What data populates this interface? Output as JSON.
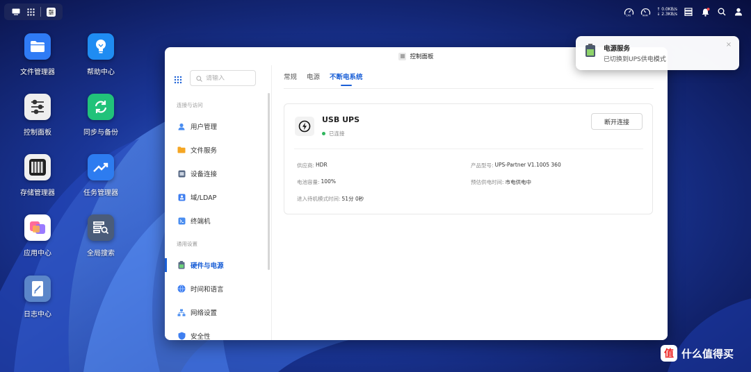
{
  "topbar": {
    "net_up": "0.0KB/s",
    "net_down": "2.3KB/s"
  },
  "desktop": {
    "icons": [
      {
        "label": "文件管理器",
        "icon": "folder-icon",
        "color": "#2f7bf5"
      },
      {
        "label": "帮助中心",
        "icon": "lightbulb-icon",
        "color": "#1f8cf2"
      },
      {
        "label": "控制面板",
        "icon": "sliders-icon",
        "color": "#eeeeee"
      },
      {
        "label": "同步与备份",
        "icon": "sync-icon",
        "color": "#21c27a"
      },
      {
        "label": "存储管理器",
        "icon": "storage-icon",
        "color": "#f0f0f0"
      },
      {
        "label": "任务管理器",
        "icon": "chart-trend-icon",
        "color": "#2d7cf0"
      },
      {
        "label": "应用中心",
        "icon": "apps-icon",
        "color": "#ffffff"
      },
      {
        "label": "全局搜索",
        "icon": "search-panel-icon",
        "color": "#4a5c7a"
      },
      {
        "label": "日志中心",
        "icon": "log-icon",
        "color": "#5b86c9"
      }
    ]
  },
  "window": {
    "title": "控制面板",
    "search_placeholder": "请输入",
    "sections": [
      {
        "heading": "连接与访问"
      },
      {
        "heading": "通用设置"
      }
    ],
    "nav": [
      {
        "label": "用户管理",
        "icon": "user-icon"
      },
      {
        "label": "文件服务",
        "icon": "folder-icon"
      },
      {
        "label": "设备连接",
        "icon": "device-icon"
      },
      {
        "label": "域/LDAP",
        "icon": "domain-icon"
      },
      {
        "label": "终端机",
        "icon": "terminal-icon"
      },
      {
        "label": "硬件与电源",
        "icon": "battery-icon",
        "active": true
      },
      {
        "label": "时间和语言",
        "icon": "globe-icon"
      },
      {
        "label": "网络设置",
        "icon": "network-icon"
      },
      {
        "label": "安全性",
        "icon": "shield-icon"
      }
    ],
    "tabs": [
      {
        "label": "常规"
      },
      {
        "label": "电源"
      },
      {
        "label": "不断电系统",
        "active": true
      }
    ],
    "ups": {
      "name": "USB UPS",
      "status": "已连接",
      "disconnect_label": "断开连接",
      "fields": [
        {
          "key": "供应商:",
          "value": "HDR"
        },
        {
          "key": "产品型号:",
          "value": "UPS-Partner V1.1005 360"
        },
        {
          "key": "电池容量:",
          "value": "100%"
        },
        {
          "key": "预估供电时间:",
          "value": "市电供电中"
        },
        {
          "key": "进入待机模式时间:",
          "value": "51分 0秒"
        }
      ]
    }
  },
  "notification": {
    "title": "电源服务",
    "message": "已切换到UPS供电模式"
  },
  "watermark": {
    "badge": "值",
    "text": "什么值得买"
  },
  "colors": {
    "accent": "#1a5fd6",
    "connected": "#2fb65d"
  }
}
